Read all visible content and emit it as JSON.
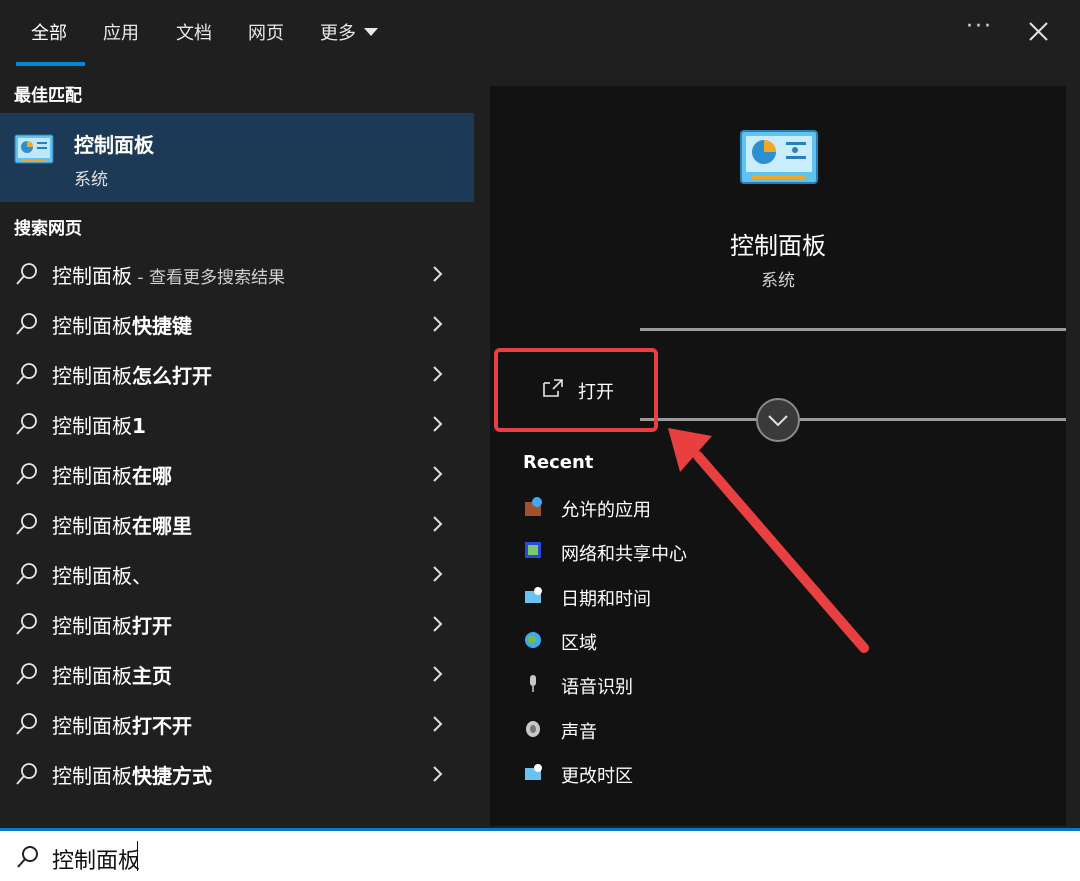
{
  "tabs": [
    "全部",
    "应用",
    "文档",
    "网页",
    "更多"
  ],
  "left": {
    "best_match_title": "最佳匹配",
    "best_match": {
      "name": "控制面板",
      "type": "系统"
    },
    "web_title": "搜索网页",
    "results": [
      {
        "prefix": "控制面板",
        "bold": "",
        "hint": " - 查看更多搜索结果"
      },
      {
        "prefix": "控制面板",
        "bold": "快捷键",
        "hint": ""
      },
      {
        "prefix": "控制面板",
        "bold": "怎么打开",
        "hint": ""
      },
      {
        "prefix": "控制面板",
        "bold": "1",
        "hint": ""
      },
      {
        "prefix": "控制面板",
        "bold": "在哪",
        "hint": ""
      },
      {
        "prefix": "控制面板",
        "bold": "在哪里",
        "hint": ""
      },
      {
        "prefix": "控制面板、",
        "bold": "",
        "hint": ""
      },
      {
        "prefix": "控制面板",
        "bold": "打开",
        "hint": ""
      },
      {
        "prefix": "控制面板",
        "bold": "主页",
        "hint": ""
      },
      {
        "prefix": "控制面板",
        "bold": "打不开",
        "hint": ""
      },
      {
        "prefix": "控制面板",
        "bold": "快捷方式",
        "hint": ""
      }
    ]
  },
  "detail": {
    "title": "控制面板",
    "subtitle": "系统",
    "open_label": "打开",
    "recent_title": "Recent",
    "recent": [
      {
        "label": "允许的应用",
        "icon": "firewall-icon"
      },
      {
        "label": "网络和共享中心",
        "icon": "network-icon"
      },
      {
        "label": "日期和时间",
        "icon": "datetime-icon"
      },
      {
        "label": "区域",
        "icon": "region-globe-icon"
      },
      {
        "label": "语音识别",
        "icon": "microphone-icon"
      },
      {
        "label": "声音",
        "icon": "speaker-icon"
      },
      {
        "label": "更改时区",
        "icon": "timezone-icon"
      }
    ]
  },
  "search": {
    "query": "控制面板"
  },
  "colors": {
    "accent": "#0a84d6",
    "selected_bg": "#1c3a55",
    "annotation_red": "#e84040"
  }
}
